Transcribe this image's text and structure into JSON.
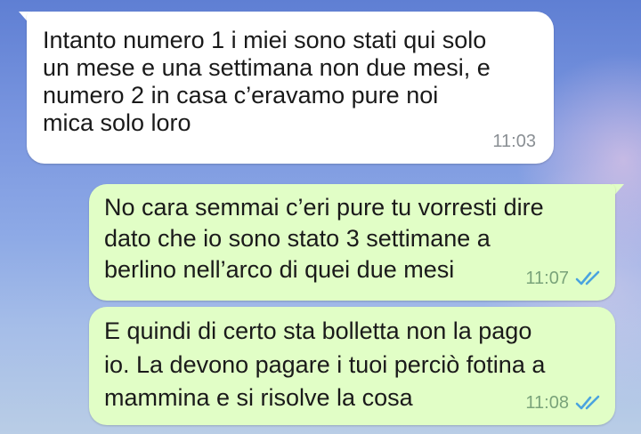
{
  "messages": [
    {
      "direction": "incoming",
      "lines": [
        "Intanto numero 1 i miei sono stati qui solo",
        "un mese e una settimana non due mesi, e",
        "numero 2 in casa c’eravamo pure noi",
        "mica solo loro"
      ],
      "time": "11:03"
    },
    {
      "direction": "outgoing",
      "lines": [
        "No cara semmai c’eri pure tu vorresti dire",
        "dato che io sono stato 3 settimane a",
        "berlino nell’arco di quei due mesi"
      ],
      "time": "11:07",
      "status_icon": "double-check-read-icon"
    },
    {
      "direction": "outgoing",
      "lines": [
        "E quindi di certo sta bolletta non la pago",
        "io. La devono pagare i tuoi perciò fotina a",
        "mammina e si risolve la cosa"
      ],
      "time": "11:08",
      "status_icon": "double-check-read-icon"
    }
  ],
  "colors": {
    "incoming_bubble": "#ffffff",
    "outgoing_bubble": "#e1fec6",
    "read_tick": "#4aa3df",
    "background_top": "#5f7fd3",
    "background_bottom": "#b9cde6"
  }
}
